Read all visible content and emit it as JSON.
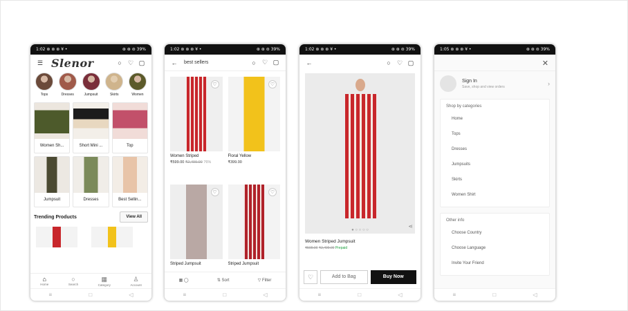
{
  "status": {
    "time1": "1:02",
    "time2": "1:02",
    "time3": "1:02",
    "time4": "1:05",
    "icons": "⊛ ⊛ ⊛ ¥ •",
    "right": "⊛ ⊛ ⊜ 39%"
  },
  "s1": {
    "logo": "Slenor",
    "categories": [
      "Tops",
      "Dresses",
      "Jumpsuit",
      "Skirts",
      "Women"
    ],
    "tiles": [
      "Women Sh...",
      "Short Mini ...",
      "Top",
      "Jumpsuit",
      "Dresses",
      "Best Sellin..."
    ],
    "trending": "Trending Products",
    "view_all": "View All",
    "bottom_nav": [
      "Home",
      "Search",
      "Category",
      "Account"
    ]
  },
  "s2": {
    "title": "best sellers",
    "products": [
      {
        "name": "Women Striped",
        "price": "₹599.00",
        "old": "₹2,499.00",
        "off": "76%"
      },
      {
        "name": "Floral Yellow",
        "price": "₹399.00",
        "old": "",
        "off": ""
      },
      {
        "name": "Striped Jumpsuit",
        "price": "",
        "old": "",
        "off": ""
      },
      {
        "name": "Striped Jumpsuit",
        "price": "",
        "old": "",
        "off": ""
      }
    ],
    "sort": "Sort",
    "filter": "Filter"
  },
  "s3": {
    "name": "Women Striped Jumpsuit",
    "price": "₹599.00",
    "old": "₹2,499.00",
    "prepaid": "Prepaid",
    "add": "Add to Bag",
    "buy": "Buy Now"
  },
  "s4": {
    "signin": "Sign In",
    "signin_sub": "Save, shop and view orders",
    "shop_by": "Shop by categories",
    "cats": [
      "Home",
      "Tops",
      "Dresses",
      "Jumpsuits",
      "Skirts",
      "Women Shirt"
    ],
    "other": "Other info",
    "others": [
      "Choose Country",
      "Choose Language",
      "Invite Your Friend"
    ]
  },
  "colors": {
    "accent": "#111111",
    "stripe_red": "#c8262b",
    "yellow": "#f2c21b"
  }
}
